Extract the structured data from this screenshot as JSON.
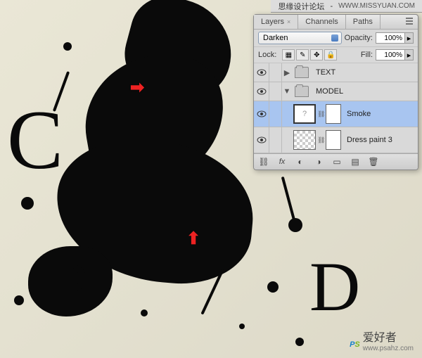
{
  "topbar": {
    "title": "思缘设计论坛",
    "url": "WWW.MISSYUAN.COM"
  },
  "panel": {
    "tabs": {
      "layers": "Layers",
      "channels": "Channels",
      "paths": "Paths"
    },
    "blend": {
      "mode": "Darken",
      "opacity_label": "Opacity:",
      "opacity": "100%"
    },
    "lock": {
      "label": "Lock:",
      "fill_label": "Fill:",
      "fill": "100%"
    },
    "layers": [
      {
        "name": "TEXT",
        "type": "group",
        "expanded": false
      },
      {
        "name": "MODEL",
        "type": "group",
        "expanded": true
      },
      {
        "name": "Smoke",
        "type": "layer",
        "selected": true,
        "mask": true
      },
      {
        "name": "Dress paint 3",
        "type": "layer",
        "selected": false,
        "mask": true
      }
    ]
  },
  "watermark": {
    "brand_p": "P",
    "brand_s": "S",
    "text": "爱好者",
    "url": "www.psahz.com"
  }
}
